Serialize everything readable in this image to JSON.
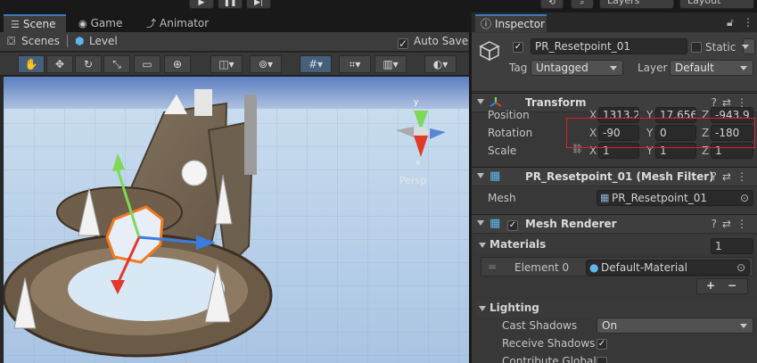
{
  "scene_tabs": [
    {
      "label": "Scene",
      "icon": "scene-icon"
    },
    {
      "label": "Game",
      "icon": "gamepad-icon"
    },
    {
      "label": "Animator",
      "icon": "animator-icon"
    }
  ],
  "breadcrumb": {
    "root": "Scenes",
    "current": "Level"
  },
  "auto_save": {
    "label": "Auto Save",
    "checked": true
  },
  "gizmo": {
    "axis_y": "y",
    "axis_x": "x",
    "persp": "Persp"
  },
  "inspector": {
    "tab_label": "Inspector",
    "gameobject": {
      "active": true,
      "name": "PR_Resetpoint_01",
      "static_label": "Static",
      "tag_label": "Tag",
      "tag_value": "Untagged",
      "layer_label": "Layer",
      "layer_value": "Default"
    },
    "transform": {
      "title": "Transform",
      "position_label": "Position",
      "rotation_label": "Rotation",
      "scale_label": "Scale",
      "position": {
        "x": "1313.2",
        "y": "17.656",
        "z": "-943.9"
      },
      "rotation": {
        "x": "-90",
        "y": "0",
        "z": "-180"
      },
      "scale": {
        "x": "1",
        "y": "1",
        "z": "1"
      },
      "axis_x": "X",
      "axis_y": "Y",
      "axis_z": "Z"
    },
    "mesh_filter": {
      "title": "PR_Resetpoint_01 (Mesh Filter)",
      "mesh_label": "Mesh",
      "mesh_value": "PR_Resetpoint_01"
    },
    "mesh_renderer": {
      "title": "Mesh Renderer",
      "enabled": true,
      "materials_label": "Materials",
      "materials_count": "1",
      "element_label": "Element 0",
      "element_value": "Default-Material",
      "add_label": "+",
      "remove_label": "−",
      "lighting_label": "Lighting",
      "cast_shadows_label": "Cast Shadows",
      "cast_shadows_value": "On",
      "receive_shadows_label": "Receive Shadows",
      "receive_shadows": true,
      "contribute_gi_label": "Contribute Global I"
    }
  },
  "topbar": {
    "layers": "Layers",
    "layout": "Layout"
  },
  "colors": {
    "accent": "#3a79bb",
    "highlight": "#e02020",
    "selection": "#f07a20"
  }
}
